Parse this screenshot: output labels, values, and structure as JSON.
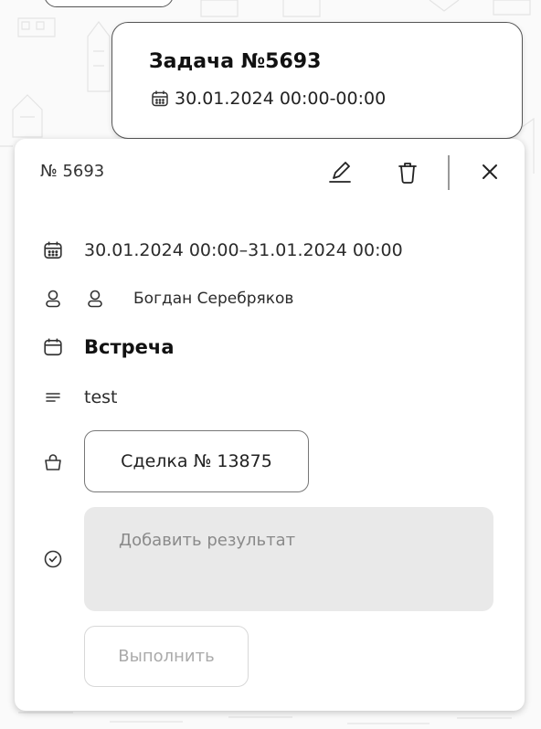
{
  "task_card": {
    "title": "Задача №5693",
    "date_range": "30.01.2024 00:00-00:00"
  },
  "panel": {
    "number": "№ 5693",
    "header_icons": [
      "pencil-icon",
      "trash-icon",
      "close-icon"
    ],
    "date_range": "30.01.2024 00:00–31.01.2024 00:00",
    "assignee": "Богдан Серебряков",
    "event_type": "Встреча",
    "description": "test",
    "deal_label": "Сделка № 13875",
    "result_placeholder": "Добавить результат",
    "complete_label": "Выполнить"
  },
  "colors": {
    "border": "#555555",
    "result_bg": "#e9e9e9",
    "muted_text": "#8a8a8a"
  }
}
